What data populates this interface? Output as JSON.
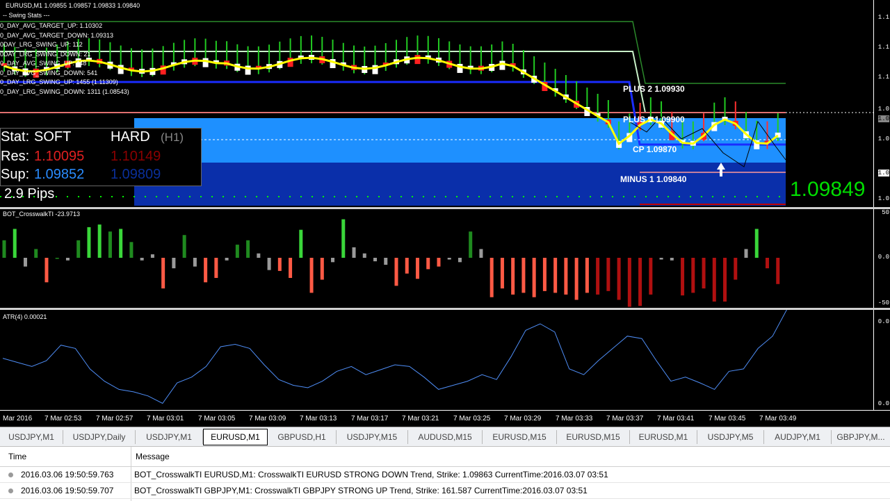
{
  "main_chart": {
    "header": "EURUSD,M1  1.09855 1.09857 1.09833 1.09840",
    "stats_title": "-- Swing Stats ---",
    "stats": [
      "0_DAY_AVG_TARGET_UP: 1.10302",
      "0_DAY_AVG_TARGET_DOWN: 1.09313",
      "0DAY_LRG_SWING_UP: 112",
      "0DAY_LRG_SWING_DOWN: 21",
      "0_DAY_AVG_SWING_UP: 448",
      "0_DAY_AVG_SWING_DOWN: 541",
      "0_DAY_LRG_SWING_UP: 1455 (1.11309)",
      "0_DAY_LRG_SWING_DOWN: 1311 (1.08543)"
    ],
    "levels": {
      "plus2": "PLUS 2 1.09930",
      "plus1": "PLUS 1 1.09900",
      "cp": "CP 1.09870",
      "minus1": "MINUS 1 1.09840"
    },
    "sr_box": {
      "stat_label": "Stat:",
      "soft_label": "SOFT",
      "hard_label": "HARD",
      "timeframe": "(H1)",
      "res_label": "Res:",
      "res_soft": "1.10095",
      "res_hard": "1.10149",
      "sup_label": "Sup:",
      "sup_soft": "1.09852",
      "sup_hard": "1.09809",
      "pips": "2.9 Pips"
    },
    "current_price": "1.09849",
    "price_scale": [
      "1.1",
      "1.1",
      "1.1",
      "1.0",
      "1.0",
      "1.0",
      "1.0",
      "1.0"
    ],
    "colors": {
      "bull": "#22aa22",
      "bear": "#ff2020",
      "ma": "#ffff00",
      "blue_line": "#1a2cff",
      "band_light": "#1e90ff",
      "band_dark": "#0a2faa",
      "price_green": "#00dd00"
    }
  },
  "indicator1": {
    "label": "BOT_CrosswalkTI -23.9713",
    "scale": [
      "50",
      "0.0",
      "-50"
    ],
    "values": [
      20,
      33,
      -10,
      10,
      -28,
      0,
      -3,
      20,
      35,
      38,
      30,
      33,
      18,
      -3,
      4,
      -35,
      -12,
      26,
      -10,
      -28,
      -23,
      -3,
      15,
      20,
      5,
      -14,
      -15,
      -23,
      32,
      -40,
      -25,
      -5,
      44,
      12,
      5,
      -4,
      -8,
      -32,
      -18,
      -24,
      -13,
      -10,
      -2,
      -5,
      30,
      10,
      -45,
      -35,
      -42,
      -40,
      -45,
      -38,
      -40,
      -42,
      -48,
      -40,
      -42,
      -38,
      -48,
      -56,
      -55,
      -42,
      -2,
      -3,
      -43,
      -40,
      -35,
      -50,
      -50,
      -25,
      10,
      33,
      -12,
      -30
    ],
    "neutral_values": [
      0,
      0,
      -10,
      0,
      0,
      0,
      -3,
      0,
      0,
      0,
      0,
      0,
      0,
      -3,
      4,
      0,
      -12,
      0,
      -10,
      0,
      0,
      -3,
      0,
      0,
      5,
      -14,
      0,
      0,
      0,
      0,
      0,
      -5,
      0,
      12,
      5,
      -4,
      -8,
      0,
      0,
      0,
      0,
      0,
      -2,
      -5,
      0,
      10,
      0,
      0,
      0,
      0,
      0,
      0,
      0,
      0,
      0,
      0,
      0,
      0,
      0,
      0,
      0,
      0,
      -2,
      -3,
      0,
      0,
      0,
      0,
      0,
      0,
      10,
      0,
      0,
      0
    ]
  },
  "indicator2": {
    "label": "ATR(4) 0.00021",
    "scale": [
      "0.0",
      "0.0"
    ],
    "values": [
      0.58,
      0.53,
      0.48,
      0.55,
      0.74,
      0.7,
      0.45,
      0.3,
      0.2,
      0.17,
      0.12,
      0.03,
      0.28,
      0.35,
      0.48,
      0.72,
      0.75,
      0.7,
      0.5,
      0.32,
      0.25,
      0.22,
      0.3,
      0.42,
      0.48,
      0.38,
      0.44,
      0.5,
      0.48,
      0.35,
      0.2,
      0.25,
      0.3,
      0.38,
      0.32,
      0.6,
      0.92,
      1.0,
      0.9,
      0.45,
      0.38,
      0.55,
      0.7,
      0.85,
      0.82,
      0.55,
      0.3,
      0.35,
      0.28,
      0.2,
      0.42,
      0.45,
      0.7,
      0.85,
      1.18
    ]
  },
  "time_axis": [
    "Mar 2016",
    "7 Mar 02:53",
    "7 Mar 02:57",
    "7 Mar 03:01",
    "7 Mar 03:05",
    "7 Mar 03:09",
    "7 Mar 03:13",
    "7 Mar 03:17",
    "7 Mar 03:21",
    "7 Mar 03:25",
    "7 Mar 03:29",
    "7 Mar 03:33",
    "7 Mar 03:37",
    "7 Mar 03:41",
    "7 Mar 03:45",
    "7 Mar 03:49"
  ],
  "tabs": [
    "USDJPY,M1",
    "USDJPY,Daily",
    "USDJPY,M1",
    "EURUSD,M1",
    "GBPUSD,H1",
    "USDJPY,M15",
    "AUDUSD,M15",
    "EURUSD,M15",
    "EURUSD,M15",
    "EURUSD,M1",
    "USDJPY,M5",
    "AUDJPY,M1",
    "GBPJPY,M..."
  ],
  "active_tab": 3,
  "log": {
    "headers": {
      "time": "Time",
      "message": "Message"
    },
    "rows": [
      {
        "time": "2016.03.06 19:50:59.763",
        "message": "BOT_CrosswalkTI EURUSD,M1: CrosswalkTI EURUSD STRONG DOWN Trend, Strike: 1.09863 CurrentTime:2016.03.07 03:51"
      },
      {
        "time": "2016.03.06 19:50:59.707",
        "message": "BOT_CrosswalkTI GBPJPY,M1: CrosswalkTI GBPJPY STRONG UP Trend, Strike: 161.587 CurrentTime:2016.03.07 03:51"
      }
    ]
  }
}
